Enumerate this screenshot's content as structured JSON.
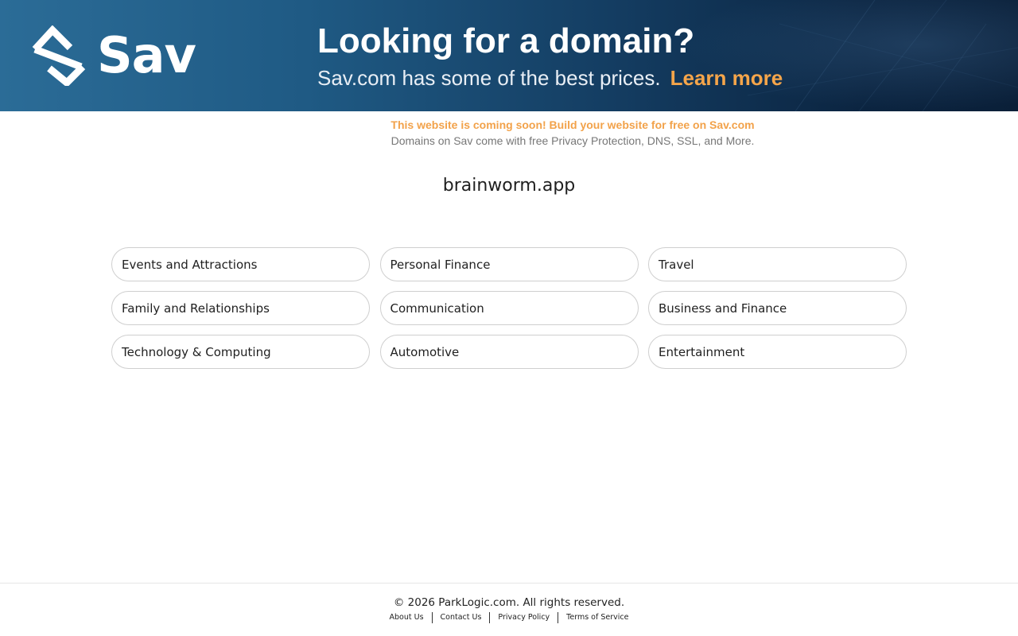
{
  "colors": {
    "banner_start": "#2b6c97",
    "banner_end": "#0a1f38",
    "accent": "#f5a54a",
    "promo": "#f2a24a"
  },
  "banner": {
    "logo_text": "Sav",
    "headline": "Looking for a domain?",
    "subline": "Sav.com has some of the best prices.",
    "learn_more": "Learn more"
  },
  "promo": {
    "title": "This website is coming soon! Build your website for free on Sav.com",
    "subtitle": "Domains on Sav come with free Privacy Protection, DNS, SSL, and More."
  },
  "domain": "brainworm.app",
  "categories": [
    "Events and Attractions",
    "Personal Finance",
    "Travel",
    "Family and Relationships",
    "Communication",
    "Business and Finance",
    "Technology & Computing",
    "Automotive",
    "Entertainment"
  ],
  "footer": {
    "copyright": "© 2026 ParkLogic.com. All rights reserved.",
    "links": [
      "About Us",
      "Contact Us",
      "Privacy Policy",
      "Terms of Service"
    ]
  }
}
